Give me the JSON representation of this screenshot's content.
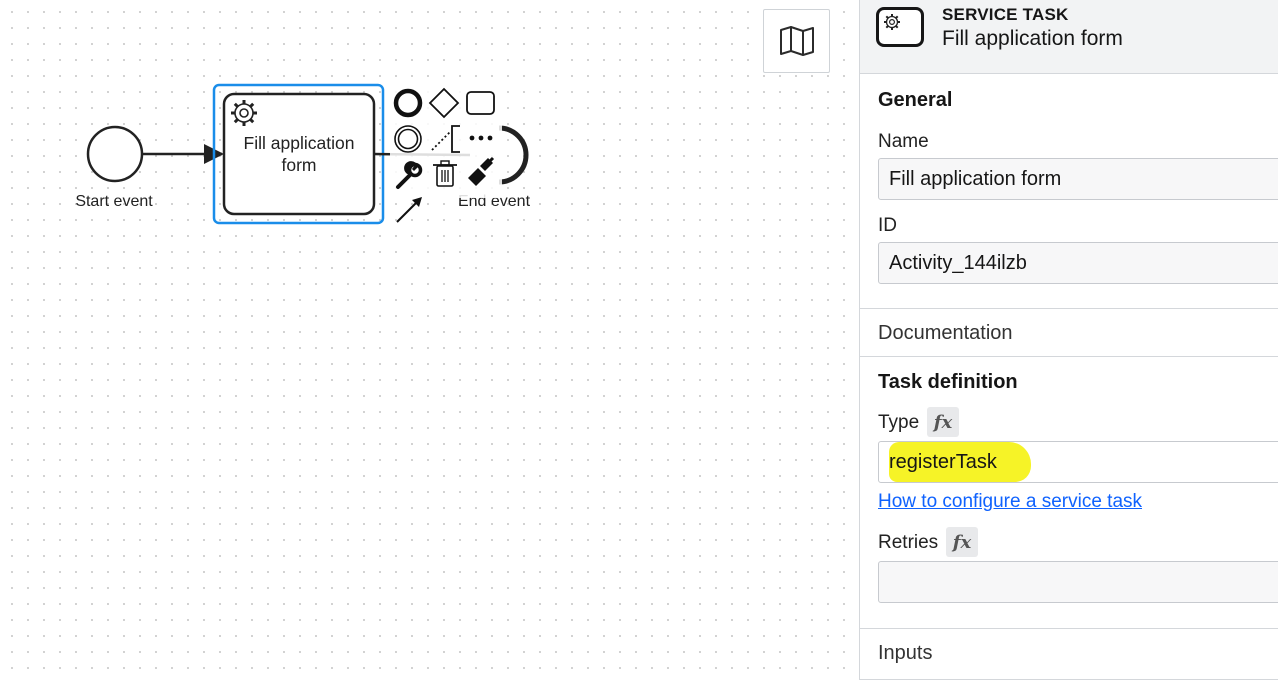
{
  "diagram": {
    "start_event_label": "Start event",
    "task_label_line1": "Fill application",
    "task_label_line2": "form",
    "end_event_label": "End event"
  },
  "context_pad": {
    "items": [
      "end-event",
      "gateway",
      "task",
      "intermediate-event",
      "text-annotation",
      "more",
      "wrench",
      "delete",
      "paint",
      "connect"
    ]
  },
  "colors": {
    "selection": "#1a8de9",
    "link": "#0f62fe",
    "highlight": "#f5f21b"
  },
  "properties": {
    "header": {
      "element_type": "SERVICE TASK",
      "element_name": "Fill application form"
    },
    "general": {
      "title": "General",
      "name_label": "Name",
      "name_value": "Fill application form",
      "id_label": "ID",
      "id_value": "Activity_144ilzb"
    },
    "documentation": {
      "title": "Documentation"
    },
    "task_definition": {
      "title": "Task definition",
      "type_label": "Type",
      "type_value": "registerTask",
      "help_link": "How to configure a service task",
      "retries_label": "Retries",
      "retries_value": "",
      "fx": "fx"
    },
    "inputs": {
      "title": "Inputs"
    }
  }
}
